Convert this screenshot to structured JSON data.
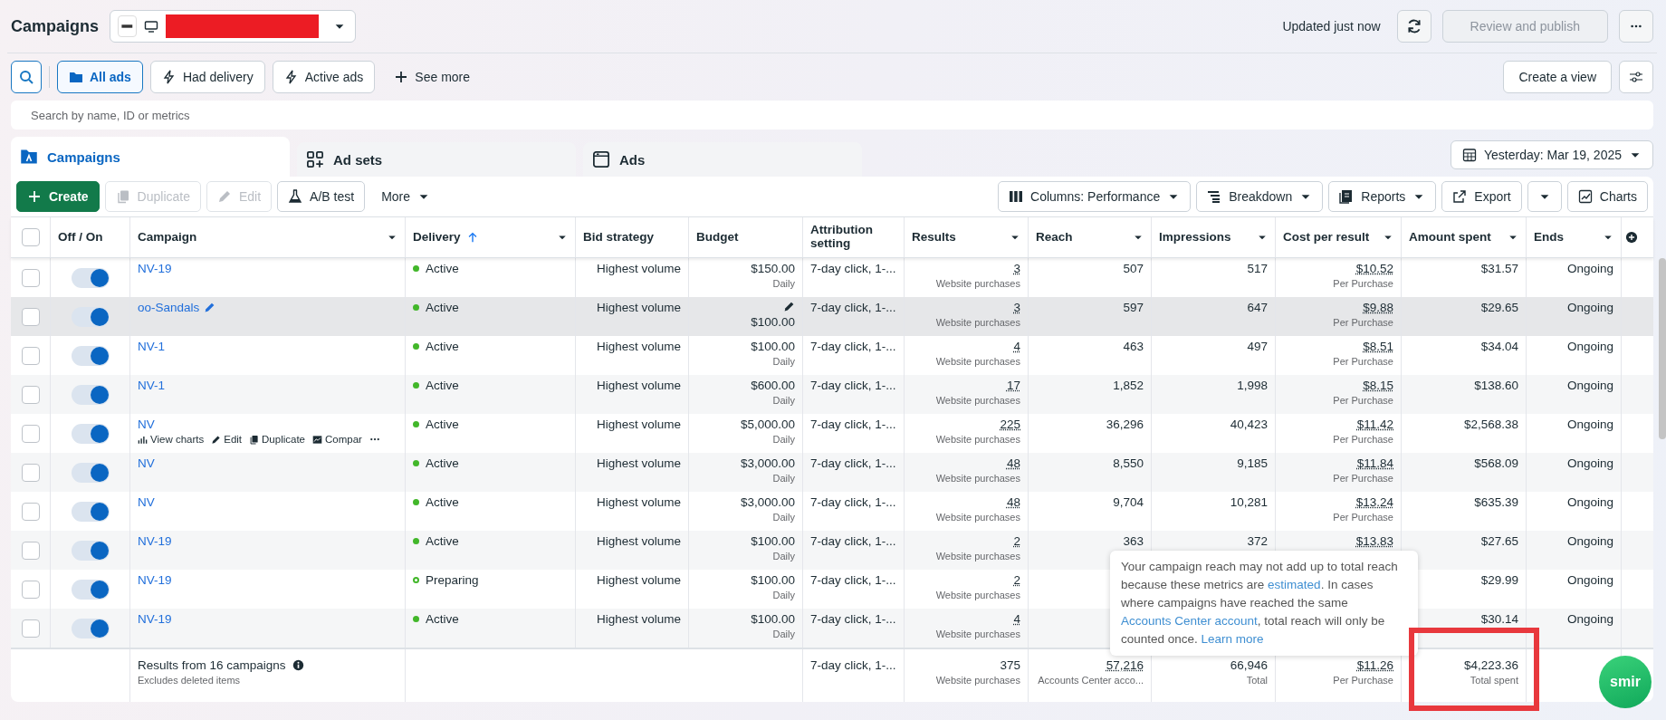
{
  "header": {
    "title": "Campaigns",
    "account_selector": {
      "redacted": true
    },
    "updated": "Updated just now",
    "publish_button": {
      "label": "Review and publish",
      "disabled": true
    }
  },
  "filters": [
    {
      "kind": "folder",
      "label": "All ads",
      "selected": true
    },
    {
      "kind": "bolt",
      "label": "Had delivery",
      "selected": false
    },
    {
      "kind": "bolt",
      "label": "Active ads",
      "selected": false
    },
    {
      "kind": "plus",
      "label": "See more",
      "selected": false
    }
  ],
  "create_view": "Create a view",
  "search": {
    "placeholder": "Search by name, ID or metrics"
  },
  "tabs": [
    {
      "kind": "campaigns",
      "label": "Campaigns",
      "selected": true
    },
    {
      "kind": "adsets",
      "label": "Ad sets",
      "selected": false
    },
    {
      "kind": "ads",
      "label": "Ads",
      "selected": false
    }
  ],
  "date_range": "Yesterday: Mar 19, 2025",
  "toolbar_left": [
    {
      "kind": "create",
      "label": "Create",
      "disabled": false
    },
    {
      "kind": "duplicate",
      "label": "Duplicate",
      "disabled": true
    },
    {
      "kind": "edit",
      "label": "Edit",
      "disabled": true
    },
    {
      "kind": "flask",
      "label": "A/B test",
      "disabled": false
    },
    {
      "kind": "more",
      "label": "More",
      "disabled": false
    }
  ],
  "toolbar_right": [
    {
      "kind": "columns",
      "label": "Columns: Performance"
    },
    {
      "kind": "breakdown",
      "label": "Breakdown"
    },
    {
      "kind": "reports",
      "label": "Reports"
    },
    {
      "kind": "export",
      "label": "Export"
    },
    {
      "kind": "caret"
    },
    {
      "kind": "charts",
      "label": "Charts"
    }
  ],
  "table": {
    "select_all_checked": false,
    "columns": [
      {
        "label": "Off / On",
        "menu": false,
        "sorted": false
      },
      {
        "label": "Campaign",
        "menu": true,
        "sorted": false
      },
      {
        "label": "Delivery",
        "menu": true,
        "sorted": true
      },
      {
        "label": "Bid strategy",
        "menu": false,
        "sorted": false
      },
      {
        "label": "Budget",
        "menu": false,
        "sorted": false
      },
      {
        "label": "Attribution setting",
        "menu": false,
        "sorted": false
      },
      {
        "label": "Results",
        "menu": true,
        "sorted": false
      },
      {
        "label": "Reach",
        "menu": true,
        "sorted": false
      },
      {
        "label": "Impressions",
        "menu": true,
        "sorted": false
      },
      {
        "label": "Cost per result",
        "menu": true,
        "sorted": false
      },
      {
        "label": "Amount spent",
        "menu": true,
        "sorted": false
      },
      {
        "label": "Ends",
        "menu": true,
        "sorted": false
      }
    ],
    "rows": [
      {
        "checked": false,
        "on": true,
        "hovered": false,
        "name": "NV-19",
        "preparing": false,
        "status_label": "Active",
        "bid": "Highest volume",
        "budget": "$150.00",
        "budget_period": "Daily",
        "attribution": "7-day click, 1-...",
        "results": "3",
        "results_label": "Website purchases",
        "reach": "507",
        "impressions": "517",
        "cost": "$10.52",
        "cost_label": "Per Purchase",
        "spent": "$31.57",
        "ends": "Ongoing"
      },
      {
        "checked": false,
        "on": true,
        "hovered": true,
        "name": "oo-Sandals",
        "preparing": false,
        "status_label": "Active",
        "bid": "Highest volume",
        "budget": "$100.00",
        "attribution": "7-day click, 1-...",
        "results": "3",
        "results_label": "Website purchases",
        "reach": "597",
        "impressions": "647",
        "cost": "$9.88",
        "cost_label": "Per Purchase",
        "spent": "$29.65",
        "ends": "Ongoing"
      },
      {
        "checked": false,
        "on": true,
        "hovered": false,
        "name": "NV-1",
        "preparing": false,
        "status_label": "Active",
        "bid": "Highest volume",
        "budget": "$100.00",
        "budget_period": "Daily",
        "attribution": "7-day click, 1-...",
        "results": "4",
        "results_label": "Website purchases",
        "reach": "463",
        "impressions": "497",
        "cost": "$8.51",
        "cost_label": "Per Purchase",
        "spent": "$34.04",
        "ends": "Ongoing"
      },
      {
        "checked": false,
        "on": true,
        "hovered": false,
        "name": "NV-1",
        "preparing": false,
        "status_label": "Active",
        "bid": "Highest volume",
        "budget": "$600.00",
        "budget_period": "Daily",
        "attribution": "7-day click, 1-...",
        "results": "17",
        "results_label": "Website purchases",
        "reach": "1,852",
        "impressions": "1,998",
        "cost": "$8.15",
        "cost_label": "Per Purchase",
        "spent": "$138.60",
        "ends": "Ongoing"
      },
      {
        "checked": false,
        "on": true,
        "hovered": false,
        "name": "NV",
        "actions": [
          {
            "kind": "chart",
            "label": "View charts"
          },
          {
            "kind": "edit",
            "label": "Edit"
          },
          {
            "kind": "duplicate",
            "label": "Duplicate"
          },
          {
            "kind": "compare",
            "label": "Compar"
          },
          {
            "kind": "dots"
          }
        ],
        "preparing": false,
        "status_label": "Active",
        "bid": "Highest volume",
        "budget": "$5,000.00",
        "budget_period": "Daily",
        "attribution": "7-day click, 1-...",
        "results": "225",
        "results_label": "Website purchases",
        "reach": "36,296",
        "impressions": "40,423",
        "cost": "$11.42",
        "cost_label": "Per Purchase",
        "spent": "$2,568.38",
        "ends": "Ongoing"
      },
      {
        "checked": false,
        "on": true,
        "hovered": false,
        "name": "NV",
        "preparing": false,
        "status_label": "Active",
        "bid": "Highest volume",
        "budget": "$3,000.00",
        "budget_period": "Daily",
        "attribution": "7-day click, 1-...",
        "results": "48",
        "results_label": "Website purchases",
        "reach": "8,550",
        "impressions": "9,185",
        "cost": "$11.84",
        "cost_label": "Per Purchase",
        "spent": "$568.09",
        "ends": "Ongoing"
      },
      {
        "checked": false,
        "on": true,
        "hovered": false,
        "name": "NV",
        "preparing": false,
        "status_label": "Active",
        "bid": "Highest volume",
        "budget": "$3,000.00",
        "budget_period": "Daily",
        "attribution": "7-day click, 1-...",
        "results": "48",
        "results_label": "Website purchases",
        "reach": "9,704",
        "impressions": "10,281",
        "cost": "$13.24",
        "cost_label": "Per Purchase",
        "spent": "$635.39",
        "ends": "Ongoing"
      },
      {
        "checked": false,
        "on": true,
        "hovered": false,
        "name": "NV-19",
        "preparing": false,
        "status_label": "Active",
        "bid": "Highest volume",
        "budget": "$100.00",
        "budget_period": "Daily",
        "attribution": "7-day click, 1-...",
        "results": "2",
        "results_label": "Website purchases",
        "reach": "363",
        "impressions": "372",
        "cost": "$13.83",
        "spent": "$27.65",
        "ends": "Ongoing"
      },
      {
        "checked": false,
        "on": true,
        "hovered": false,
        "name": "NV-19",
        "preparing": true,
        "status_label": "Preparing",
        "bid": "Highest volume",
        "budget": "$100.00",
        "budget_period": "Daily",
        "attribution": "7-day click, 1-...",
        "results": "2",
        "results_label": "Website purchases",
        "spent": "$29.99",
        "ends": "Ongoing"
      },
      {
        "checked": false,
        "on": true,
        "hovered": false,
        "name": "NV-19",
        "preparing": false,
        "status_label": "Active",
        "bid": "Highest volume",
        "budget": "$100.00",
        "budget_period": "Daily",
        "attribution": "7-day click, 1-...",
        "results": "4",
        "results_label": "Website purchases",
        "spent": "$30.14",
        "ends": "Ongoing"
      }
    ],
    "footer": {
      "summary": "Results from 16 campaigns",
      "summary_note": "Excludes deleted items",
      "attribution": "7-day click, 1-...",
      "results": "375",
      "results_label": "Website purchases",
      "reach": "57,216",
      "reach_label": "Accounts Center acco...",
      "impressions": "66,946",
      "impressions_label": "Total",
      "cost": "$11.26",
      "cost_label": "Per Purchase",
      "spent": "$4,223.36",
      "spent_label": "Total spent"
    }
  },
  "tooltip": [
    {
      "text": "Your campaign reach may not add up to total reach because these metrics are ",
      "link": false
    },
    {
      "text": "estimated",
      "link": true
    },
    {
      "text": ". In cases where campaigns have reached the same ",
      "link": false
    },
    {
      "text": "Accounts Center account",
      "link": true
    },
    {
      "text": ", total reach will only be counted once. ",
      "link": false
    },
    {
      "text": "Learn more",
      "link": true
    }
  ],
  "annotations": [
    {
      "kind": "frame",
      "color": "#e8383d"
    }
  ],
  "floating_badge": {
    "label": "smir"
  }
}
